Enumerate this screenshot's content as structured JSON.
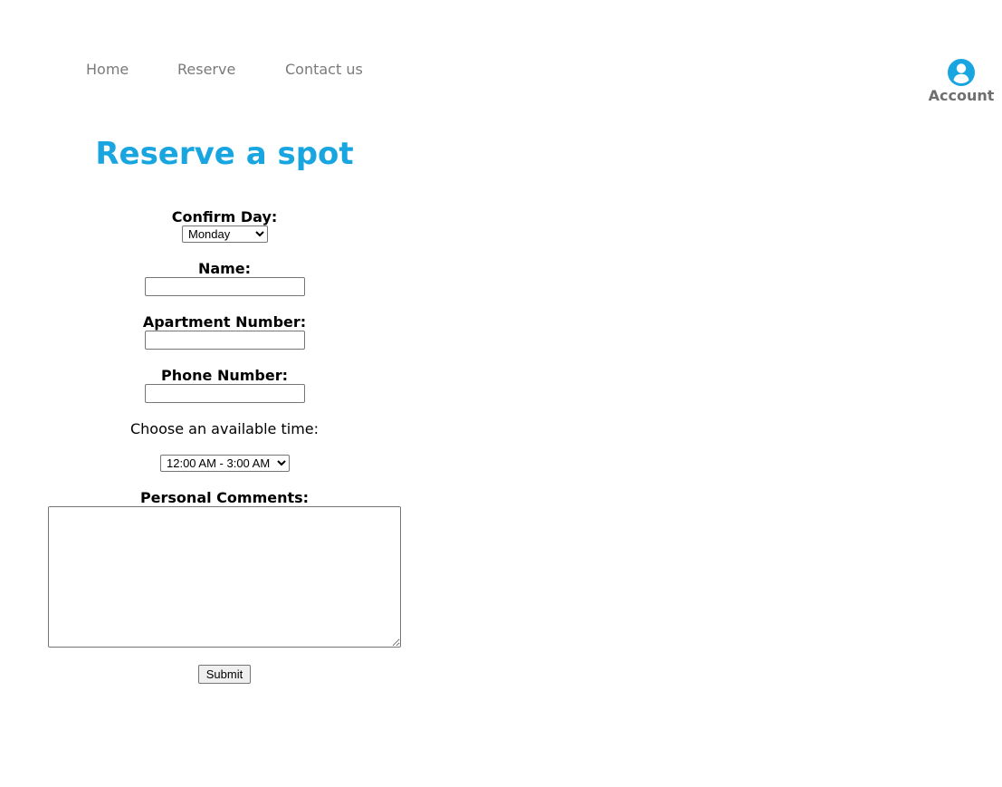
{
  "nav": {
    "home": "Home",
    "reserve": "Reserve",
    "contact": "Contact us"
  },
  "account": {
    "label": "Account",
    "icon": "account-circle-icon",
    "icon_color": "#19a6e0"
  },
  "page": {
    "title": "Reserve a spot",
    "title_color": "#19a6e0"
  },
  "form": {
    "day_label": "Confirm Day:",
    "day_selected": "Monday",
    "name_label": "Name:",
    "name_value": "",
    "apartment_label": "Apartment Number:",
    "apartment_value": "",
    "phone_label": "Phone Number:",
    "phone_value": "",
    "time_label": "Choose an available time:",
    "time_selected": "12:00 AM - 3:00 AM",
    "comments_label": "Personal Comments:",
    "comments_value": "",
    "submit_label": "Submit"
  }
}
